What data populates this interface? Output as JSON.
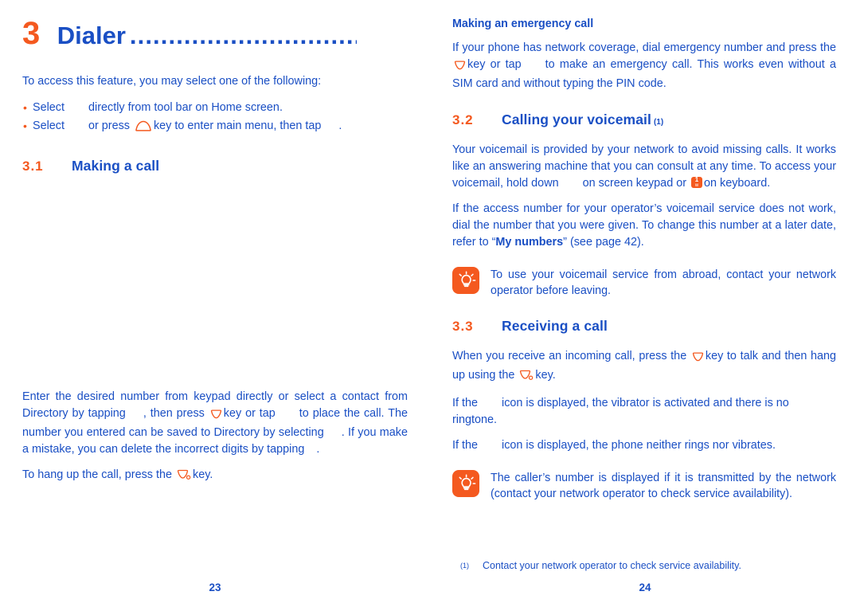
{
  "colors": {
    "blue": "#1a4fc4",
    "orange": "#f4591f",
    "white": "#ffffff"
  },
  "left_page": {
    "chapter": {
      "number": "3",
      "title": "Dialer",
      "dots": "...................................."
    },
    "intro": "To access this feature, you may select one of the following:",
    "bullets": [
      {
        "before": "Select",
        "icon": "dialer-app-icon",
        "after": "directly from tool bar on Home screen."
      },
      {
        "before": "Select",
        "icon": "dialer-app-icon",
        "middle": "or press",
        "key_icon": "home-key-icon",
        "after": "key to enter main menu, then tap",
        "tail_icon": "dialer-app-icon",
        "end": "."
      }
    ],
    "section": {
      "number": "3.1",
      "title": "Making a call"
    },
    "paragraph_1_parts": {
      "p1": "Enter the desired number from keypad directly or select a contact from Directory by tapping",
      "p2": ", then press",
      "key": "call-key-icon",
      "p3": "key or tap",
      "p4": "to place the call. The number you entered can be saved to Directory by selecting",
      "p5": ". If you make a mistake, you can delete the incorrect digits by tapping",
      "p6": "."
    },
    "paragraph_2_parts": {
      "p1": "To hang up the call, press the",
      "key": "end-call-key-icon",
      "p2": "key."
    },
    "page_number": "23"
  },
  "right_page": {
    "subhead": "Making an emergency call",
    "emergency_parts": {
      "p1": "If your phone has network coverage, dial emergency number and press the",
      "key": "call-key-icon",
      "p2": "key or tap",
      "p3": "to make an emergency call. This works even without a SIM card and without typing the PIN code."
    },
    "section_voicemail": {
      "number": "3.2",
      "title": "Calling your voicemail",
      "superscript": "(1)"
    },
    "voicemail_parts": {
      "p1": "Your voicemail is provided by your network to avoid missing calls. It works like an answering machine that you can consult at any time. To access your voicemail, hold down",
      "p2": "on screen keypad or",
      "kbd_top": "1",
      "kbd_bottom": "w",
      "p3": "on keyboard."
    },
    "access_number_parts": {
      "p1": "If the access number for your operator’s voicemail service does not work, dial the number that you were given. To change this number at a later date, refer to “",
      "bold": "My numbers",
      "p2": "” (see page 42)."
    },
    "tip_1": {
      "icon": "lightbulb-tip-icon",
      "text": "To use your voicemail service from abroad, contact your network operator before leaving."
    },
    "section_receiving": {
      "number": "3.3",
      "title": "Receiving a call"
    },
    "receiving_parts": {
      "p1": "When you receive an incoming call, press the",
      "key_call": "call-key-icon",
      "p2": "key to talk and then hang up using the",
      "key_end": "end-call-key-icon",
      "p3": "key."
    },
    "vibrate_parts": {
      "p1": "If the",
      "icon": "vibrate-status-icon",
      "p2": "icon is displayed, the vibrator is activated and there is no ringtone."
    },
    "silent_parts": {
      "p1": "If the",
      "icon": "silent-status-icon",
      "p2": "icon is displayed, the phone neither rings nor vibrates."
    },
    "tip_2": {
      "icon": "lightbulb-tip-icon",
      "text": "The caller’s number is displayed if it is transmitted by the network (contact your network operator to check service availability)."
    },
    "footnote": {
      "mark": "(1)",
      "text": "Contact your network operator to check service availability."
    },
    "page_number": "24"
  }
}
